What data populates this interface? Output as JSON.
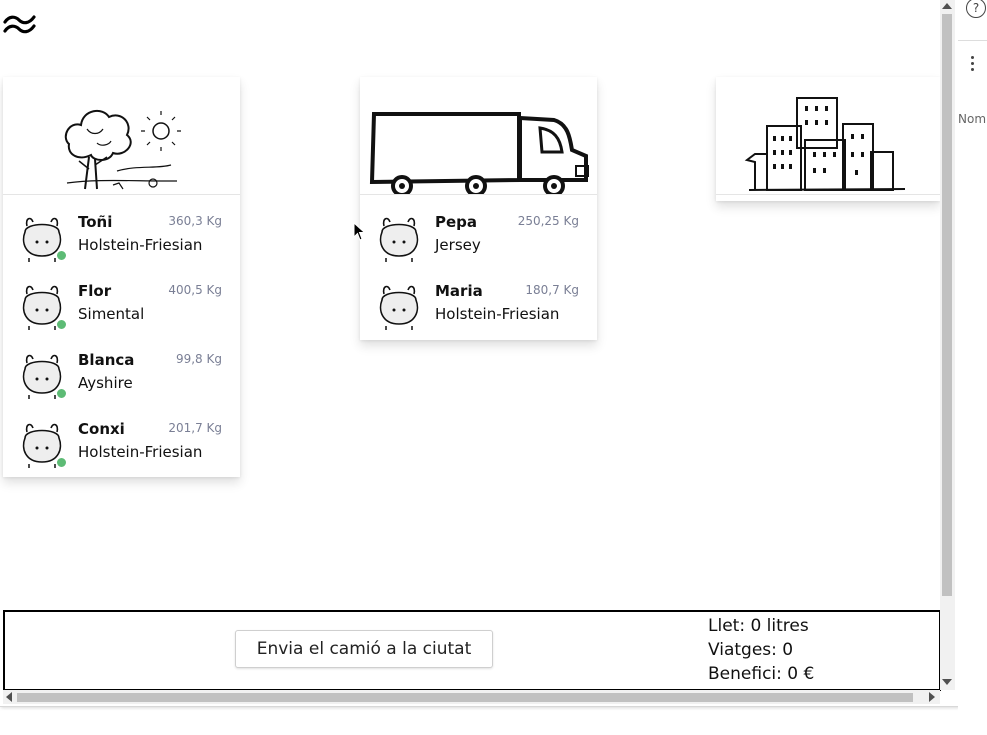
{
  "farm": {
    "cows": [
      {
        "name": "Toñi",
        "breed": "Holstein-Friesian",
        "weight": "360,3 Kg"
      },
      {
        "name": "Flor",
        "breed": "Simental",
        "weight": "400,5 Kg"
      },
      {
        "name": "Blanca",
        "breed": "Ayshire",
        "weight": "99,8 Kg"
      },
      {
        "name": "Conxi",
        "breed": "Holstein-Friesian",
        "weight": "201,7 Kg"
      }
    ]
  },
  "truck": {
    "cows": [
      {
        "name": "Pepa",
        "breed": "Jersey",
        "weight": "250,25 Kg"
      },
      {
        "name": "Maria",
        "breed": "Holstein-Friesian",
        "weight": "180,7 Kg"
      }
    ]
  },
  "footer": {
    "send_button_label": "Envia el camió a la ciutat",
    "milk": "Llet: 0 litres",
    "trips": "Viatges: 0",
    "profit": "Benefici: 0 €"
  },
  "side_panel": {
    "help_glyph": "?",
    "name_label": "Nom"
  },
  "colors": {
    "status_dot": "#5dbb75",
    "weight_text": "#7a7f95"
  }
}
